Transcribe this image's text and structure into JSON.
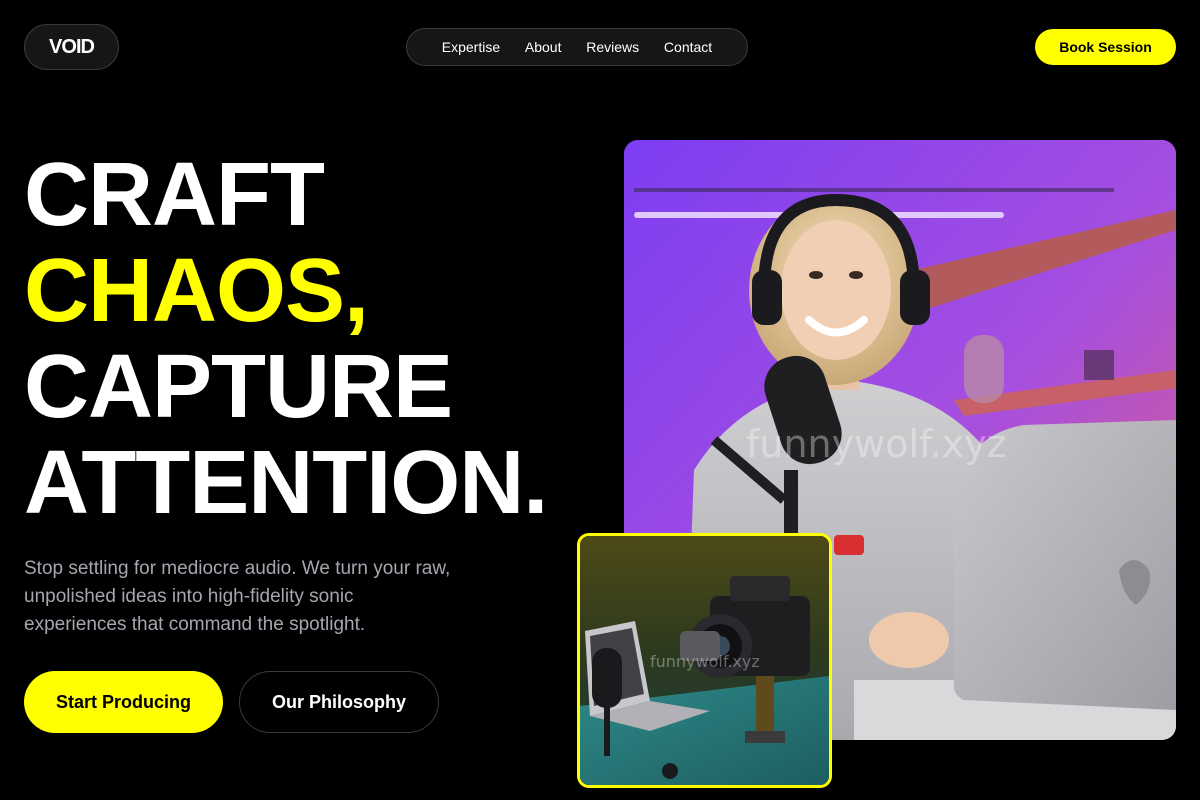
{
  "header": {
    "logo": "VOID",
    "nav": [
      "Expertise",
      "About",
      "Reviews",
      "Contact"
    ],
    "book_label": "Book Session"
  },
  "hero": {
    "line1": "CRAFT",
    "line2": "CHAOS,",
    "line3": "CAPTURE",
    "line4": "ATTENTION.",
    "subtext": "Stop settling for mediocre audio. We turn your raw, unpolished ideas into high-fidelity sonic experiences that command the spotlight.",
    "primary_cta": "Start Producing",
    "secondary_cta": "Our Philosophy"
  },
  "images": {
    "watermark": "funnywolf.xyz"
  },
  "colors": {
    "accent": "#ffff00",
    "background": "#000000",
    "muted_text": "#a6a6b0"
  }
}
